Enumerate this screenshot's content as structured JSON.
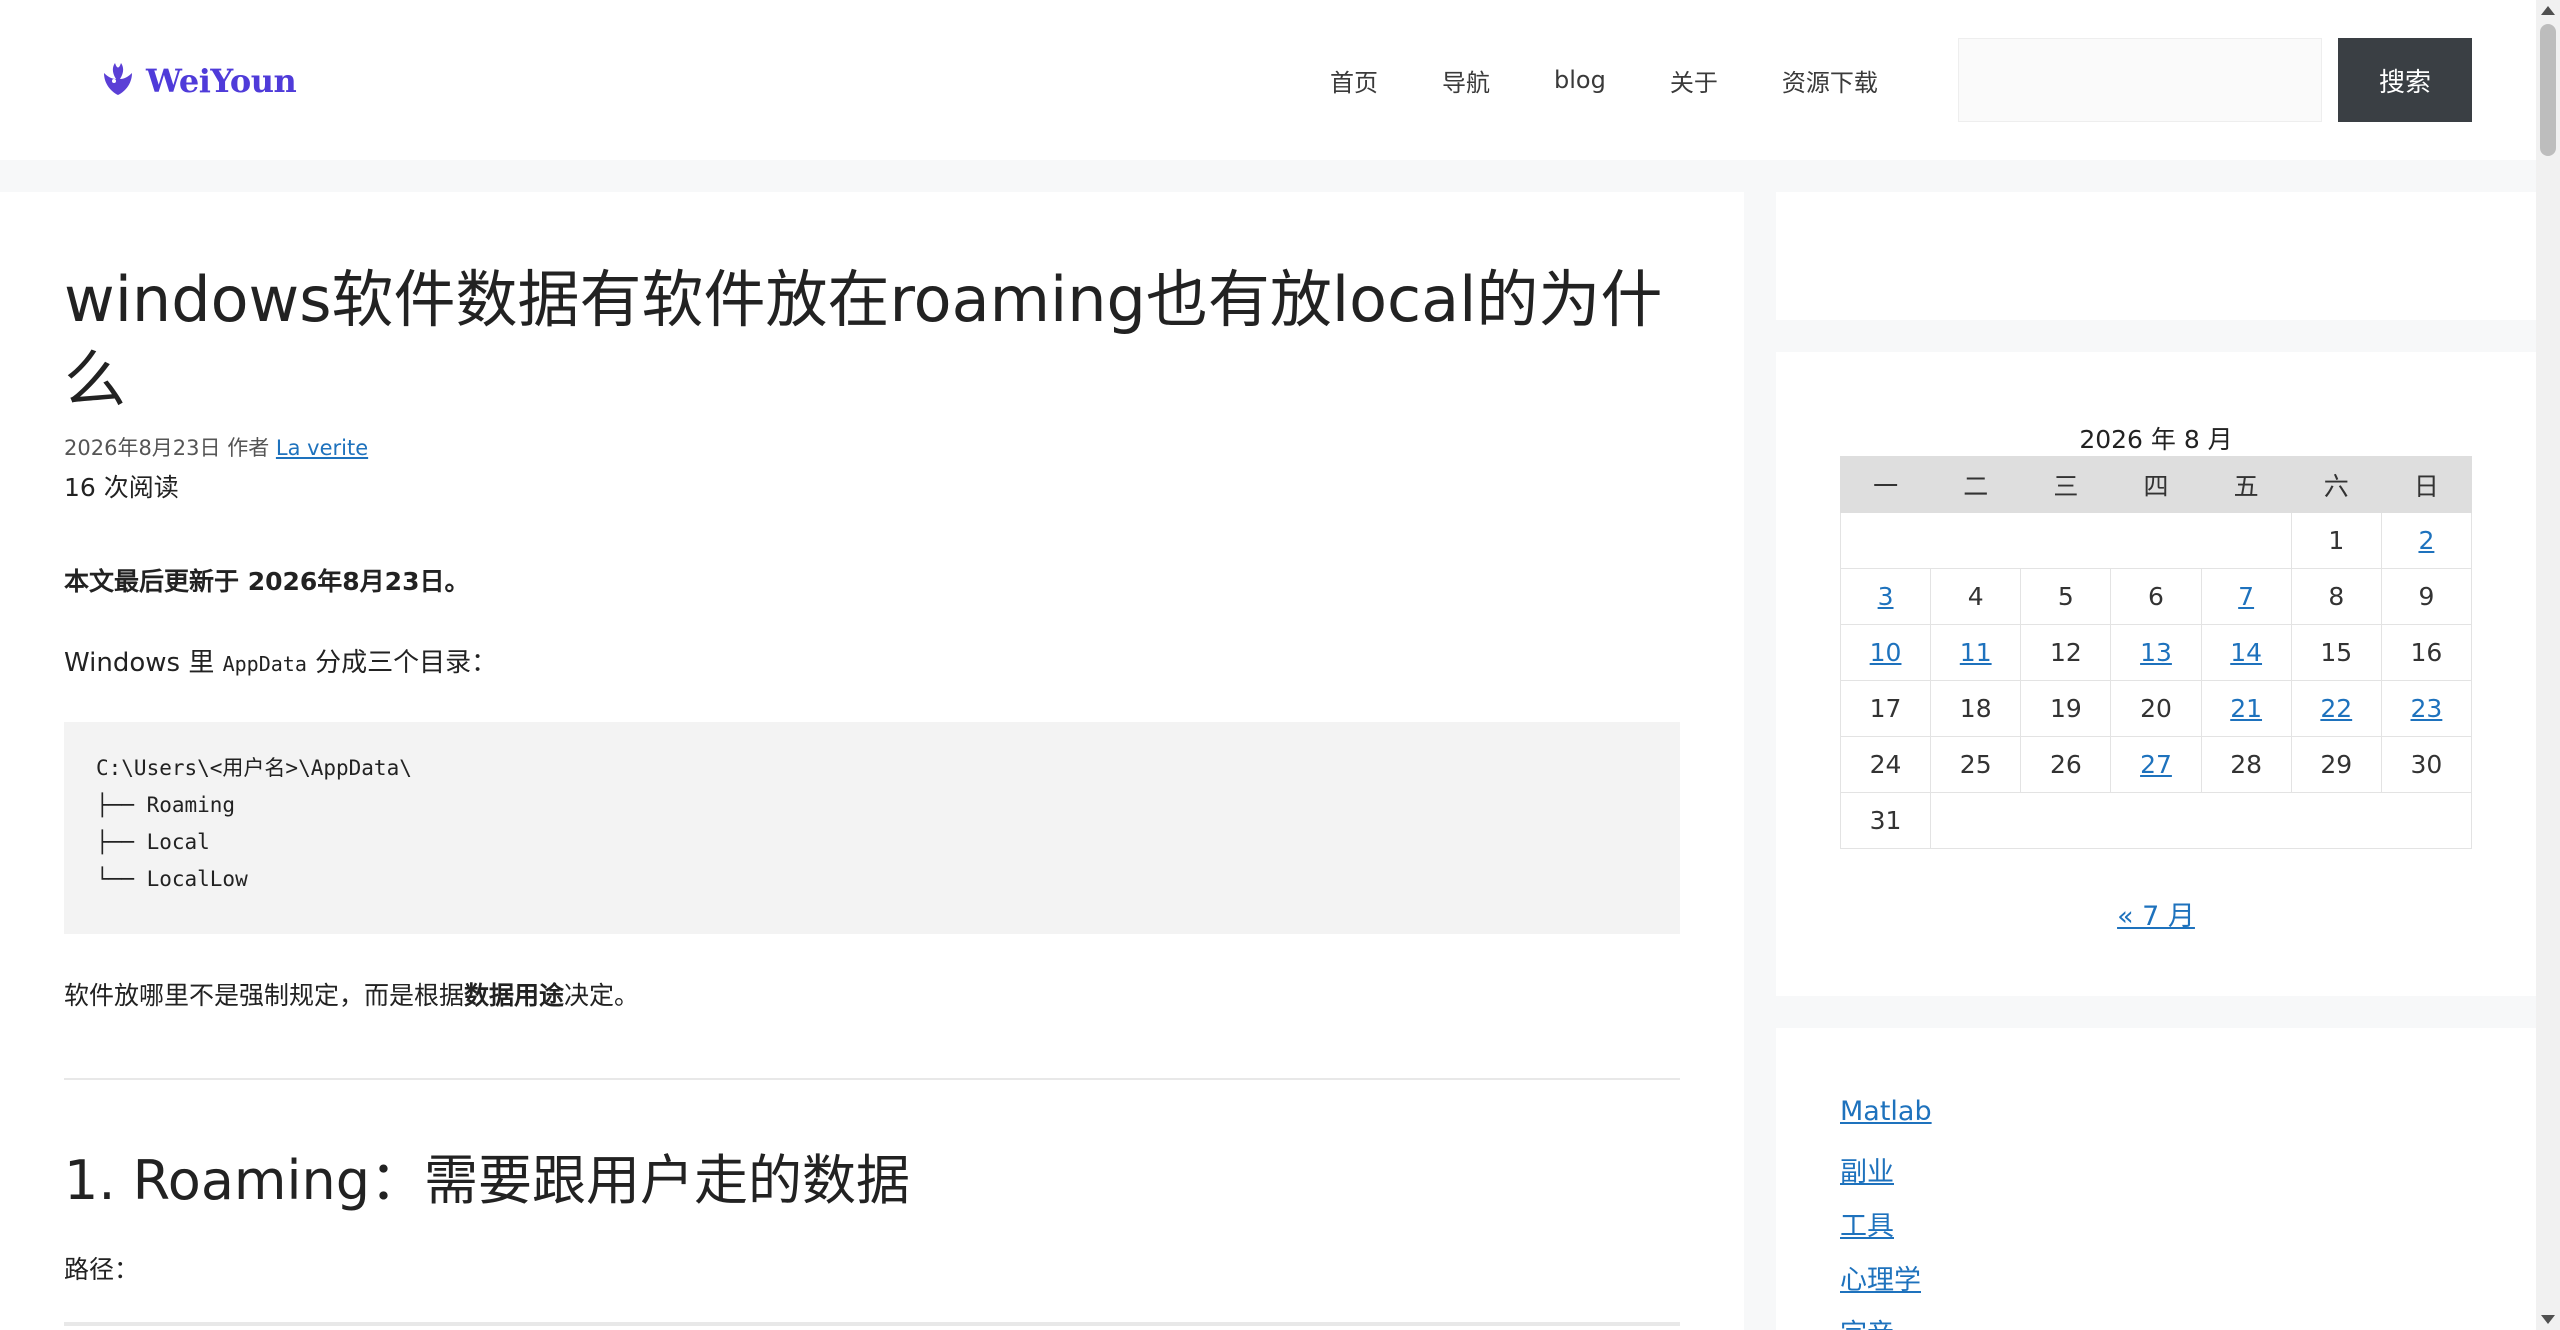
{
  "header": {
    "logo_text": "WeiYoun",
    "nav": [
      "首页",
      "导航",
      "blog",
      "关于",
      "资源下载"
    ],
    "search_button": "搜索",
    "search_value": ""
  },
  "article": {
    "title": "windows软件数据有软件放在roaming也有放local的为什么",
    "date": "2026年8月23日",
    "author_label": "作者",
    "author": "La verite",
    "views": "16 次阅读",
    "updated": "本文最后更新于 2026年8月23日。",
    "intro_prefix": "Windows 里 ",
    "intro_code": "AppData",
    "intro_suffix": " 分成三个目录：",
    "code_block": "C:\\Users\\<用户名>\\AppData\\\n├── Roaming\n├── Local\n└── LocalLow",
    "para2_prefix": "软件放哪里不是强制规定，而是根据",
    "para2_bold": "数据用途",
    "para2_suffix": "决定。",
    "h2": "1. Roaming：需要跟用户走的数据",
    "path_label": "路径："
  },
  "calendar": {
    "caption": "2026 年 8 月",
    "weekdays": [
      "一",
      "二",
      "三",
      "四",
      "五",
      "六",
      "日"
    ],
    "linked_days": [
      2,
      3,
      7,
      10,
      11,
      13,
      14,
      21,
      22,
      23,
      27
    ],
    "prev_link": "« 7 月"
  },
  "categories": [
    "Matlab",
    "副业",
    "工具",
    "心理学",
    "宗音"
  ]
}
